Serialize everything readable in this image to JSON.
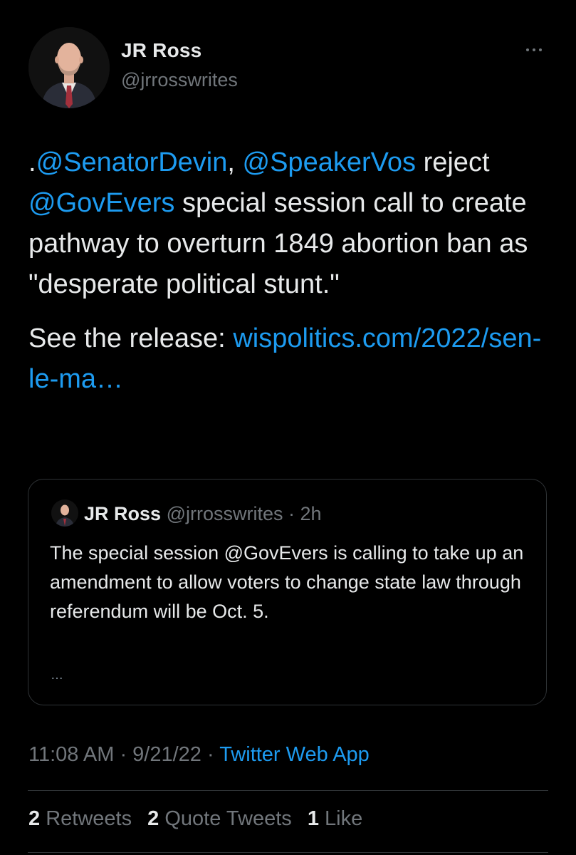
{
  "author": {
    "name": "JR Ross",
    "handle": "@jrrosswrites",
    "avatar_icon": "profile-photo"
  },
  "more_icon": "more-dots-icon",
  "tweet": {
    "paragraph1": {
      "prefix": ".",
      "mention1": "@SenatorDevin",
      "sep1": ", ",
      "mention2": "@SpeakerVos",
      "text1": " reject ",
      "mention3": "@GovEvers",
      "text2": " special session call to create pathway to overturn 1849 abortion ban as \"desperate political stunt.\""
    },
    "paragraph2": {
      "text": "See the release: ",
      "link": "wispolitics.com/2022/sen-le-ma…"
    }
  },
  "quoted_tweet": {
    "name": "JR Ross",
    "handle": "@jrrosswrites",
    "dot": " · ",
    "time": "2h",
    "text": "The special session @GovEvers is calling to take up an amendment to allow voters to change state law through referendum will be Oct. 5.",
    "ellipsis": "…"
  },
  "meta": {
    "time": "11:08 AM",
    "sep1": " · ",
    "date": "9/21/22",
    "sep2": " · ",
    "source": "Twitter Web App"
  },
  "stats": {
    "retweets_count": "2",
    "retweets_label": "Retweets",
    "quotes_count": "2",
    "quotes_label": "Quote Tweets",
    "likes_count": "1",
    "likes_label": "Like"
  },
  "colors": {
    "background": "#000000",
    "text": "#e7e9ea",
    "muted": "#71767b",
    "link": "#1d9bf0",
    "border": "#2f3336"
  }
}
